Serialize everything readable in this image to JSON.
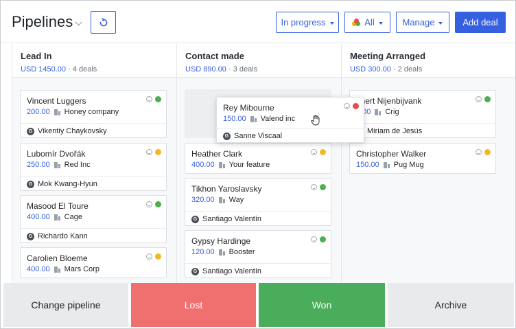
{
  "header": {
    "title": "Pipelines",
    "filters": {
      "status_label": "In progress",
      "owner_label": "All",
      "manage_label": "Manage"
    },
    "add_deal_label": "Add deal"
  },
  "columns": [
    {
      "title": "Lead In",
      "sum": "USD 1450.00",
      "deals": "· 4 deals",
      "cards": [
        {
          "name": "Vincent Luggers",
          "amount": "200.00",
          "org": "Honey company",
          "person": "Vikentiy Chaykovsky",
          "status": "#4caf50"
        },
        {
          "name": "Lubomír Dvořák",
          "amount": "250.00",
          "org": "Red Inc",
          "person": "Mok Kwang-Hyun",
          "status": "#f2b826"
        },
        {
          "name": "Masood El Toure",
          "amount": "400.00",
          "org": "Cage",
          "person": "Richardo Kann",
          "status": "#4caf50"
        },
        {
          "name": "Carolien Bloeme",
          "amount": "400.00",
          "org": "Mars Corp",
          "person": "",
          "status": "#f2b826"
        }
      ]
    },
    {
      "title": "Contact made",
      "sum": "USD 890.00",
      "deals": "· 3 deals",
      "cards": [
        {
          "name": "Heather Clark",
          "amount": "400.00",
          "org": "Your feature",
          "person": "",
          "status": "#f2b826"
        },
        {
          "name": "Tikhon Yaroslavsky",
          "amount": "320.00",
          "org": "Way",
          "person": "Santiago Valentín",
          "status": "#4caf50"
        },
        {
          "name": "Gypsy Hardinge",
          "amount": "120.00",
          "org": "Booster",
          "person": "Santiago Valentín",
          "status": "#4caf50"
        }
      ]
    },
    {
      "title": "Meeting Arranged",
      "sum": "USD 300.00",
      "deals": "· 2 deals",
      "cards": [
        {
          "name": "nnert Nijenbijvank",
          "amount": "0.00",
          "org": "Crig",
          "person": "Miriam de Jesús",
          "status": "#4caf50"
        },
        {
          "name": "Christopher Walker",
          "amount": "150.00",
          "org": "Pug Mug",
          "person": "",
          "status": "#f2b826"
        }
      ]
    }
  ],
  "dragging": {
    "name": "Rey Mibourne",
    "amount": "150.00",
    "org": "Valend inc",
    "person": "Sanne Viscaal",
    "status": "#e84b4b"
  },
  "avatar_letter": "G",
  "actions": {
    "change": "Change pipeline",
    "lost": "Lost",
    "won": "Won",
    "archive": "Archive"
  },
  "colors": {
    "accent": "#3560e0",
    "won": "#4aad5c",
    "lost": "#f07070"
  }
}
